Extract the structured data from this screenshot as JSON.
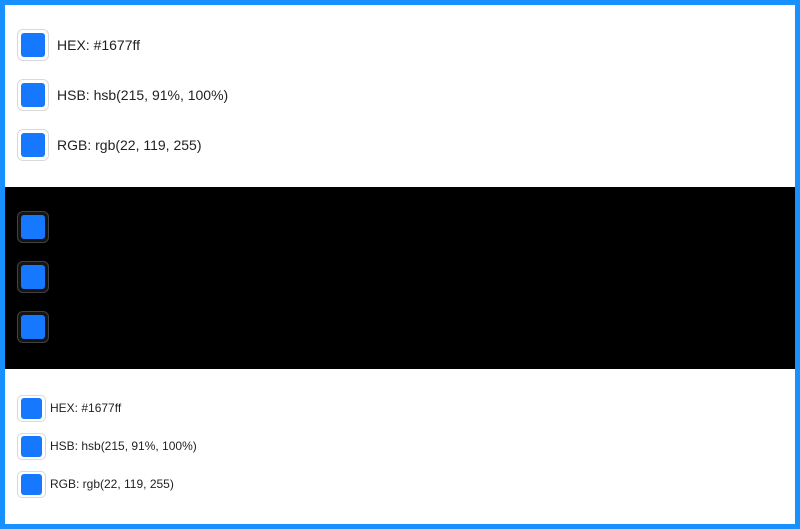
{
  "accent_color": "#1677ff",
  "frame_color": "#1890ff",
  "light_section": {
    "items": [
      {
        "label": "HEX: #1677ff"
      },
      {
        "label": "HSB: hsb(215, 91%, 100%)"
      },
      {
        "label": "RGB: rgb(22, 119, 255)"
      }
    ]
  },
  "dark_section": {
    "items": [
      {
        "label": ""
      },
      {
        "label": ""
      },
      {
        "label": ""
      }
    ]
  },
  "small_section": {
    "items": [
      {
        "label": "HEX: #1677ff"
      },
      {
        "label": "HSB: hsb(215, 91%, 100%)"
      },
      {
        "label": "RGB: rgb(22, 119, 255)"
      }
    ]
  }
}
